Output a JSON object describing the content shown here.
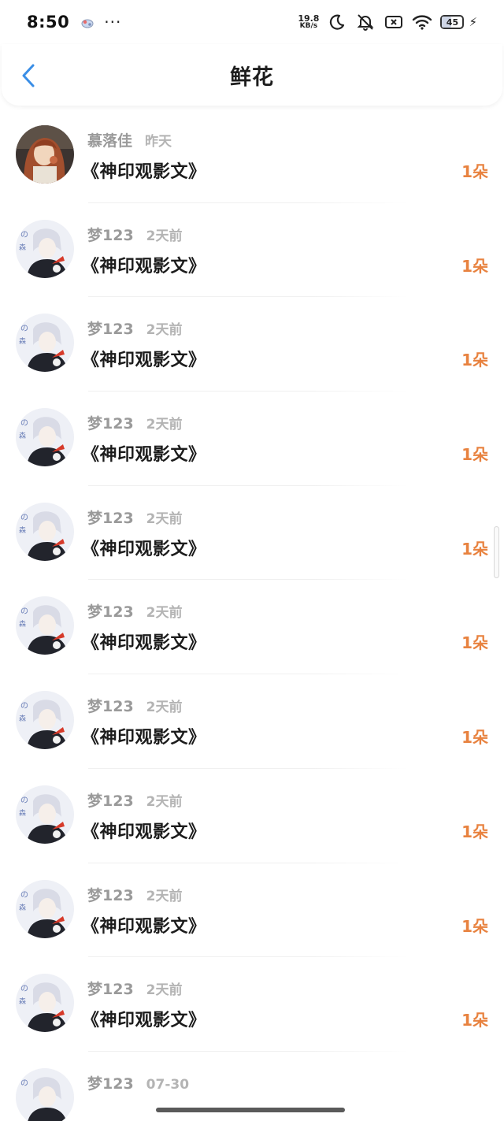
{
  "status_bar": {
    "time": "8:50",
    "more": "···",
    "net_speed_value": "19.8",
    "net_speed_unit": "KB/s",
    "battery_level": "45"
  },
  "header": {
    "title": "鲜花"
  },
  "colors": {
    "accent_blue": "#3a8ee6",
    "flower_orange": "#e8823f"
  },
  "items": [
    {
      "username": "慕落佳",
      "time": "昨天",
      "title": "《神印观影文》",
      "count": "1朵",
      "avatar": "avatar-girl"
    },
    {
      "username": "梦123",
      "time": "2天前",
      "title": "《神印观影文》",
      "count": "1朵",
      "avatar": "avatar-anime-boy"
    },
    {
      "username": "梦123",
      "time": "2天前",
      "title": "《神印观影文》",
      "count": "1朵",
      "avatar": "avatar-anime-boy"
    },
    {
      "username": "梦123",
      "time": "2天前",
      "title": "《神印观影文》",
      "count": "1朵",
      "avatar": "avatar-anime-boy"
    },
    {
      "username": "梦123",
      "time": "2天前",
      "title": "《神印观影文》",
      "count": "1朵",
      "avatar": "avatar-anime-boy"
    },
    {
      "username": "梦123",
      "time": "2天前",
      "title": "《神印观影文》",
      "count": "1朵",
      "avatar": "avatar-anime-boy"
    },
    {
      "username": "梦123",
      "time": "2天前",
      "title": "《神印观影文》",
      "count": "1朵",
      "avatar": "avatar-anime-boy"
    },
    {
      "username": "梦123",
      "time": "2天前",
      "title": "《神印观影文》",
      "count": "1朵",
      "avatar": "avatar-anime-boy"
    },
    {
      "username": "梦123",
      "time": "2天前",
      "title": "《神印观影文》",
      "count": "1朵",
      "avatar": "avatar-anime-boy"
    },
    {
      "username": "梦123",
      "time": "2天前",
      "title": "《神印观影文》",
      "count": "1朵",
      "avatar": "avatar-anime-boy"
    },
    {
      "username": "梦123",
      "time": "07-30",
      "title": "",
      "count": "",
      "avatar": "avatar-anime-boy"
    }
  ]
}
